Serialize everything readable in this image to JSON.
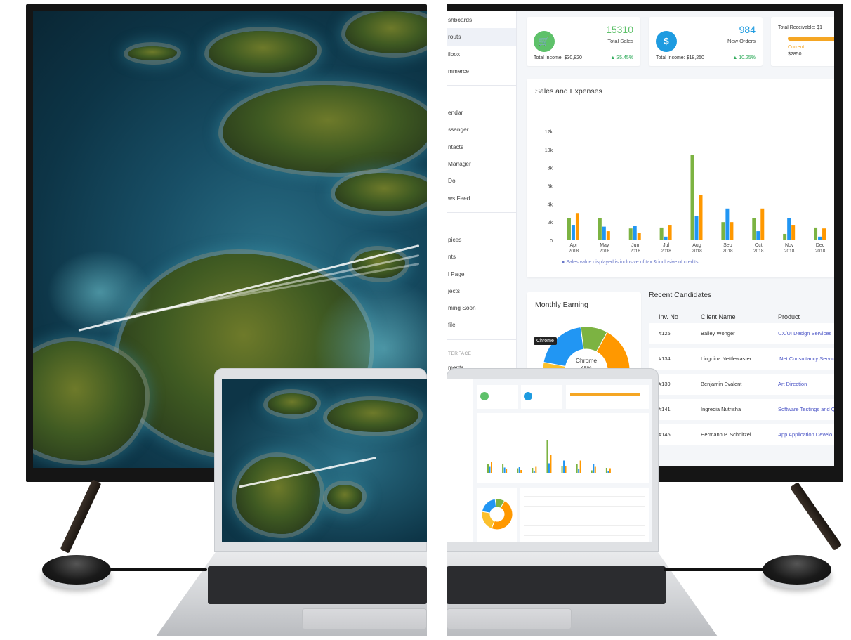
{
  "dashboard": {
    "sidebar": {
      "items": [
        "shboards",
        "routs",
        "ilbox",
        "mmerce"
      ],
      "items2": [
        "endar",
        "ssanger",
        "ntacts",
        "Manager",
        "Do",
        "ws Feed"
      ],
      "items3": [
        "pices",
        "nts",
        "l Page",
        "jects",
        "ming Soon",
        "file"
      ],
      "section_head": "TERFACE",
      "items4": [
        "ments",
        "........"
      ]
    },
    "stats": {
      "sales_number": "15310",
      "sales_label": "Total Sales",
      "sales_income": "Total Income: $30,820",
      "sales_change": "▲ 35.45%",
      "orders_number": "984",
      "orders_label": "New Orders",
      "orders_income": "Total Income: $18,250",
      "orders_change": "▲ 10.25%",
      "receivable_label": "Total Receivable: $1",
      "current_label": "Current",
      "current_value": "$2850"
    },
    "sales_expenses": {
      "title": "Sales and Expenses",
      "note": "Sales value displayed is inclusive of tax & inclusive of credits."
    },
    "monthly": {
      "title": "Monthly Earning",
      "tooltip": "Chrome",
      "center_label": "Chrome",
      "center_value": "48%"
    },
    "candidates": {
      "title": "Recent Candidates",
      "headers": [
        "Inv. No",
        "Client Name",
        "Product"
      ],
      "rows": [
        {
          "inv": "#125",
          "client": "Bailey Wonger",
          "product": "UX/UI Design Services"
        },
        {
          "inv": "#134",
          "client": "Linguina Nettlewaster",
          "product": ".Net Consultancy Servic"
        },
        {
          "inv": "#139",
          "client": "Benjamin Evalent",
          "product": "Art Direction"
        },
        {
          "inv": "#141",
          "client": "Ingredia Nutrisha",
          "product": "Software Testings and Q"
        },
        {
          "inv": "#145",
          "client": "Hermann P. Schnitzel",
          "product": "App Application Develo"
        }
      ]
    },
    "colors": {
      "green": "#7cb342",
      "blue": "#2196f3",
      "orange": "#ff9800",
      "yellow": "#fbc02d"
    }
  },
  "chart_data": {
    "type": "bar",
    "categories": [
      "Apr 2018",
      "May 2018",
      "Jun 2018",
      "Jul 2018",
      "Aug 2018",
      "Sep 2018",
      "Oct 2018",
      "Nov 2018",
      "Dec 2018"
    ],
    "yticks": [
      "0",
      "2k",
      "4k",
      "6k",
      "8k",
      "10k",
      "12k"
    ],
    "ylim": [
      0,
      12000
    ],
    "series": [
      {
        "color": "#7cb342",
        "values": [
          2400,
          2400,
          1300,
          1400,
          9400,
          2000,
          2400,
          700,
          1400
        ]
      },
      {
        "color": "#2196f3",
        "values": [
          1700,
          1500,
          1600,
          400,
          2700,
          3500,
          1000,
          2400,
          400
        ]
      },
      {
        "color": "#ff9800",
        "values": [
          3000,
          1000,
          800,
          1700,
          5000,
          2000,
          3500,
          1700,
          1300
        ]
      }
    ],
    "pie": [
      {
        "label": "Chrome",
        "value": 48,
        "color": "#ff9800"
      },
      {
        "value": 22,
        "color": "#fbc02d"
      },
      {
        "value": 20,
        "color": "#2196f3"
      },
      {
        "value": 10,
        "color": "#7cb342"
      }
    ]
  }
}
